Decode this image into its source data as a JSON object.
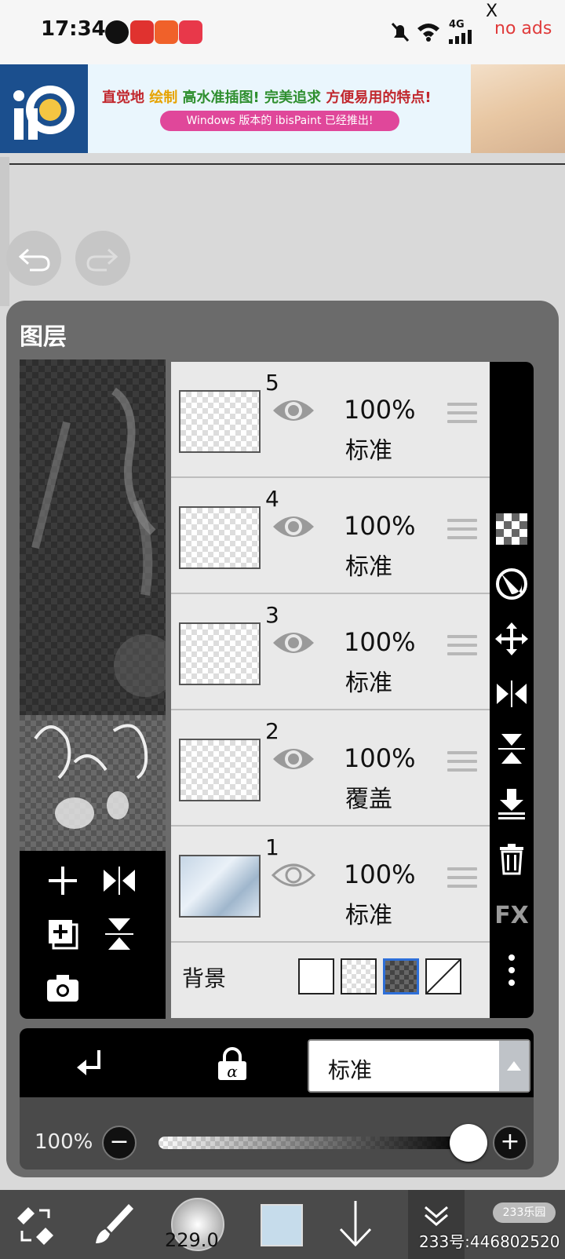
{
  "status_bar": {
    "time": "17:34",
    "network": "4G",
    "ads_close": "X",
    "ads_label": "no ads"
  },
  "banner": {
    "headline_parts": [
      {
        "text": "直觉地",
        "color": "#c1272d"
      },
      {
        "text": " 绘制",
        "color": "#e6a300"
      },
      {
        "text": " 高水准插图!",
        "color": "#2f8f2f"
      },
      {
        "text": " 完美追求",
        "color": "#2f8f2f"
      },
      {
        "text": " 方便易用的特点!",
        "color": "#c1272d"
      }
    ],
    "subline": "Windows 版本的 ibisPaint 已经推出!"
  },
  "panel": {
    "title": "图层"
  },
  "layers": [
    {
      "number": "5",
      "opacity": "100%",
      "blend": "标准"
    },
    {
      "number": "4",
      "opacity": "100%",
      "blend": "标准"
    },
    {
      "number": "3",
      "opacity": "100%",
      "blend": "标准"
    },
    {
      "number": "2",
      "opacity": "100%",
      "blend": "覆盖"
    },
    {
      "number": "1",
      "opacity": "100%",
      "blend": "标准"
    }
  ],
  "background": {
    "label": "背景",
    "selected_swatch": "dark-checker"
  },
  "right_tools": {
    "fx_label": "FX"
  },
  "blend_mode": {
    "value": "标准"
  },
  "opacity": {
    "label": "100%",
    "value_fraction": 1.0
  },
  "toolbar": {
    "brush_size": "229.0",
    "color": "#c6dceb"
  },
  "watermark": {
    "text": "233号:446802520",
    "logo": "233乐园"
  }
}
